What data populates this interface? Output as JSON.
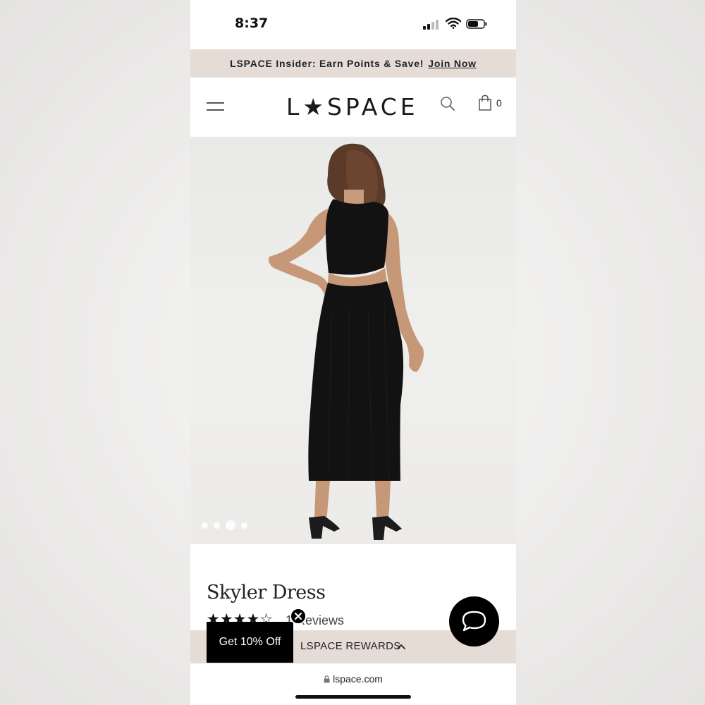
{
  "status_bar": {
    "time": "8:37"
  },
  "promo": {
    "text": "LSPACE Insider: Earn Points & Save!",
    "link": "Join Now"
  },
  "header": {
    "logo": "L★SPACE",
    "cart_count": "0"
  },
  "gallery": {
    "total_images": 4,
    "active_index": 2
  },
  "product": {
    "title": "Skyler Dress",
    "stars": "★★★★☆",
    "reviews_text": "1 Reviews"
  },
  "rewards": {
    "label": "LSPACE REWARDS",
    "offer": "Get 10% Off"
  },
  "browser": {
    "url": "lspace.com"
  },
  "colors": {
    "banner_bg": "#e6dcd6",
    "dress": "#111111",
    "accent": "#000000"
  }
}
